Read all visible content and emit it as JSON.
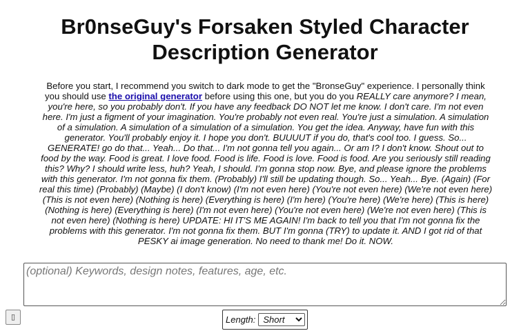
{
  "header": {
    "title": "Br0nseGuy's Forsaken Styled Character Description Generator"
  },
  "intro": {
    "part1": "Before you start, I recommend you switch to dark mode to get the \"BronseGuy\" experience. I personally think you should use ",
    "link_text": "the original generator",
    "part2": " before using this one, but you do you ",
    "italic_text": "REALLY care anymore? I mean, you're here, so you probably don't. If you have any feedback DO NOT let me know. I don't care. I'm not even here. I'm just a figment of your imagination. You're probably not even real. You're just a simulation. A simulation of a simulation. A simulation of a simulation of a simulation. You get the idea. Anyway, have fun with this generator. You'll probably enjoy it. I hope you don't. BUUUUT if you do, that's cool too. I guess. So... GENERATE! go do that... Yeah... Do that... I'm not gonna tell you again... Or am I? I don't know. Shout out to food by the way. Food is great. I love food. Food is life. Food is love. Food is food. Are you seriously still reading this? Why? I should write less, huh? Yeah, I should. I'm gonna stop now. Bye, and please ignore the problems with this generator. I'm not gonna fix them. (Probably) I'll still be updating though. So... Yeah... Bye. (Again) (For real this time) (Probably) (Maybe) (I don't know) (I'm not even here) (You're not even here) (We're not even here) (This is not even here) (Nothing is here) (Everything is here) (I'm here) (You're here) (We're here) (This is here) (Nothing is here) (Everything is here) (I'm not even here) (You're not even here) (We're not even here) (This is not even here) (Nothing is here) UPDATE: HI IT'S ME AGAIN! I'm back to tell you that I'm not gonna fix the problems with this generator. I'm not gonna fix them. BUT I'm gonna (TRY) to update it. AND I got rid of that PESKY ai image generation. No need to thank me! Do it. NOW."
  },
  "keywords_input": {
    "value": "",
    "placeholder": "(optional) Keywords, design notes, features, age, etc."
  },
  "corner_button": {
    "icon": "missing-glyph-icon",
    "glyph": "▯"
  },
  "length": {
    "label": "Length:",
    "selected": "Short"
  }
}
